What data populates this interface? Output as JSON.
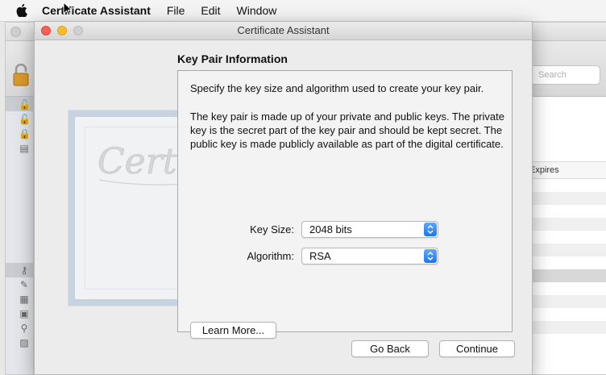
{
  "menubar": {
    "app_name": "Certificate Assistant",
    "items": [
      "File",
      "Edit",
      "Window"
    ]
  },
  "background_window": {
    "search_placeholder": "Search",
    "table_header": "Expires"
  },
  "dialog": {
    "window_title": "Certificate Assistant",
    "section_title": "Key Pair Information",
    "paragraph_1": "Specify the key size and algorithm used to create your key pair.",
    "paragraph_2": "The key pair is made up of your private and public keys. The private key is the secret part of the key pair and should be kept secret. The public key is made publicly available as part of the digital certificate.",
    "key_size_label": "Key Size:",
    "key_size_value": "2048 bits",
    "algorithm_label": "Algorithm:",
    "algorithm_value": "RSA",
    "learn_more_label": "Learn More...",
    "back_label": "Go Back",
    "continue_label": "Continue",
    "watermark_text": "Certificate"
  },
  "colors": {
    "close_button": "#fc5f57",
    "minimize_button": "#fdbc2e",
    "popup_accent": "#1b74f1"
  },
  "icons": [
    "apple-icon",
    "pointer-cursor-icon",
    "keychain-lock-icon",
    "chevron-updown-icon"
  ]
}
